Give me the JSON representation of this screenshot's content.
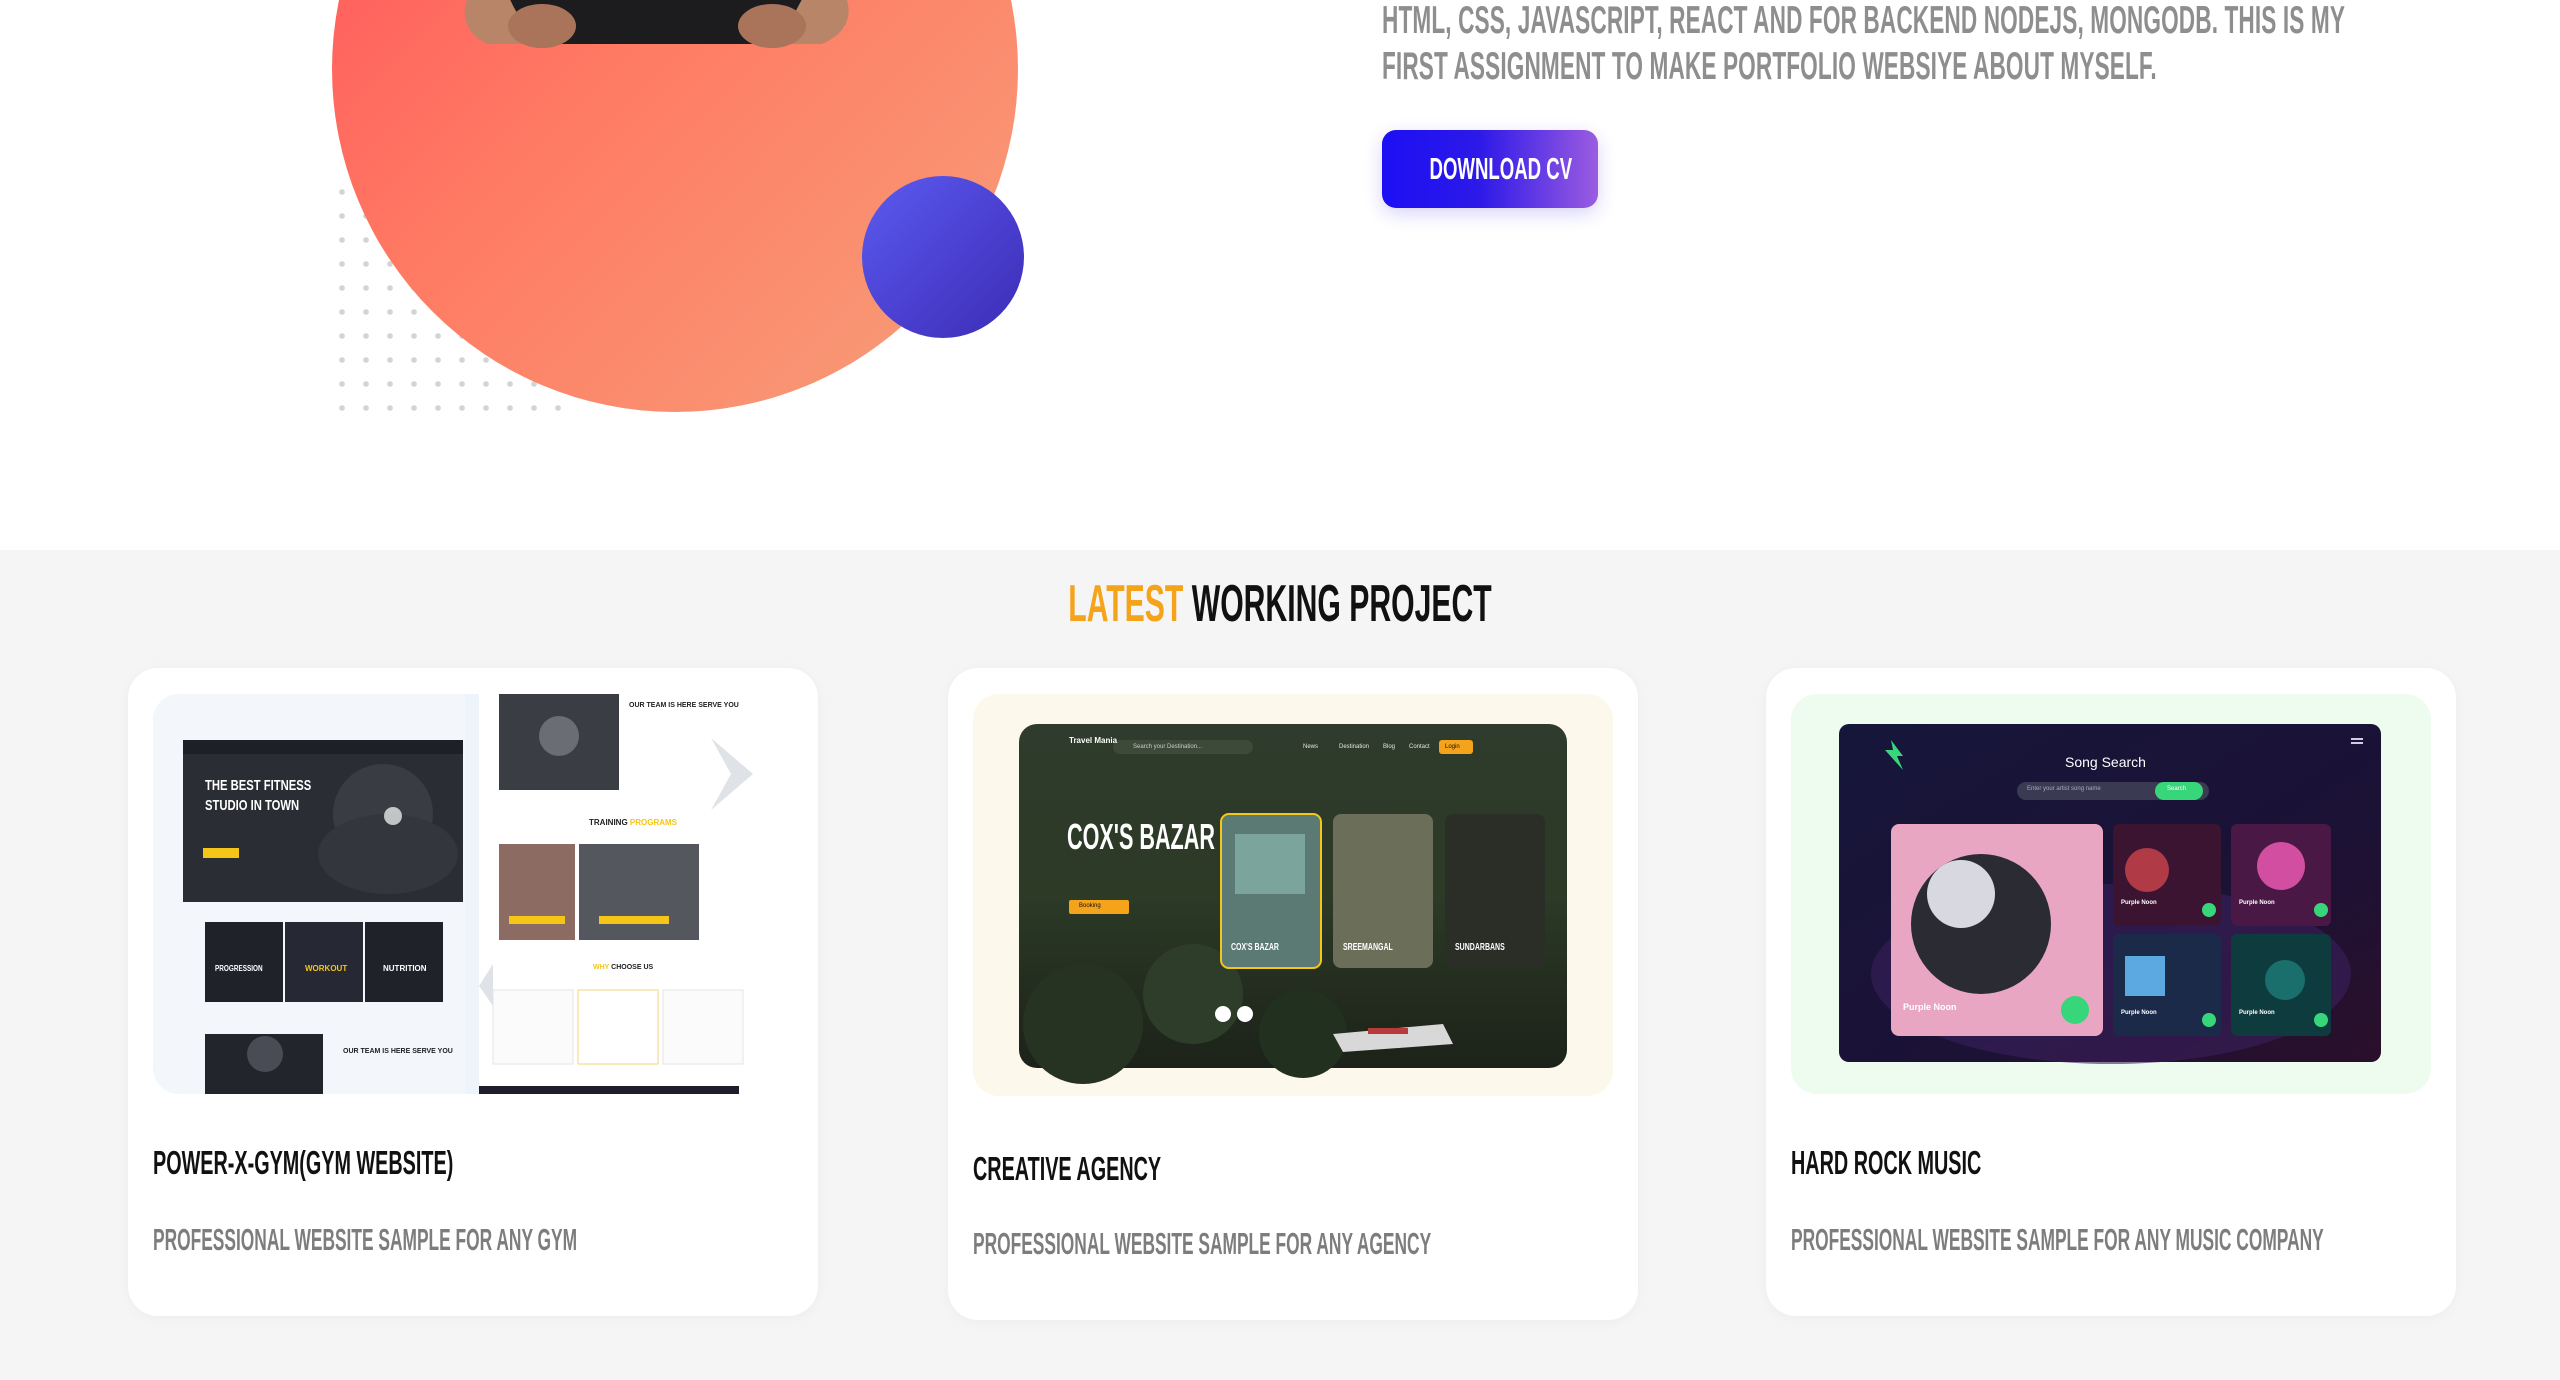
{
  "hero": {
    "about_line1": "HTML, CSS, JAVASCRIPT, REACT AND FOR BACKEND NODEJS, MONGODB. THIS IS MY",
    "about_line2": "FIRST ASSIGNMENT TO MAKE PORTFOLIO WEBSIYE ABOUT MYSELF.",
    "cv_button": "DOWNLOAD CV"
  },
  "projects": {
    "title_accent": "LATEST",
    "title_main": "WORKING PROJECT",
    "cards": [
      {
        "name": "POWER-X-GYM(GYM WEBSITE)",
        "description": "PROFESSIONAL WEBSITE SAMPLE FOR ANY GYM",
        "preview": {
          "hero_line1": "THE BEST FITNESS",
          "hero_line2": "STUDIO IN TOWN",
          "team_heading": "OUR TEAM IS HERE SERVE YOU",
          "training": "TRAINING",
          "programs": "PROGRAMS",
          "cat1": "PROGRESSION",
          "cat2": "WORKOUT",
          "cat3": "NUTRITION",
          "why": "WHY",
          "choose": "CHOOSE US",
          "team_heading2": "OUR TEAM IS HERE SERVE YOU"
        }
      },
      {
        "name": "CREATIVE AGENCY",
        "description": "PROFESSIONAL WEBSITE SAMPLE FOR ANY AGENCY",
        "preview": {
          "logo": "Travel Mania",
          "search_placeholder": "Search your Destination...",
          "nav": [
            "News",
            "Destination",
            "Blog",
            "Contact"
          ],
          "login": "Login",
          "headline": "COX'S BAZAR",
          "booking": "Booking",
          "slides": [
            "COX'S BAZAR",
            "SREEMANGAL",
            "SUNDARBANS"
          ]
        }
      },
      {
        "name": "HARD ROCK MUSIC",
        "description": "PROFESSIONAL WEBSITE SAMPLE FOR ANY MUSIC COMPANY",
        "preview": {
          "heading": "Song Search",
          "search_placeholder": "Enter your artist song name",
          "search_button": "Search",
          "tiles": [
            "Purple Noon",
            "Purple Noon",
            "Purple Noon",
            "Purple Noon",
            "Purple Noon"
          ]
        }
      }
    ]
  },
  "colors": {
    "accent": "#f5a31a",
    "hero_ring": "#ff6a5e",
    "cv_gradient_start": "#1b0ff4",
    "cv_gradient_end": "#9b5ce0"
  }
}
